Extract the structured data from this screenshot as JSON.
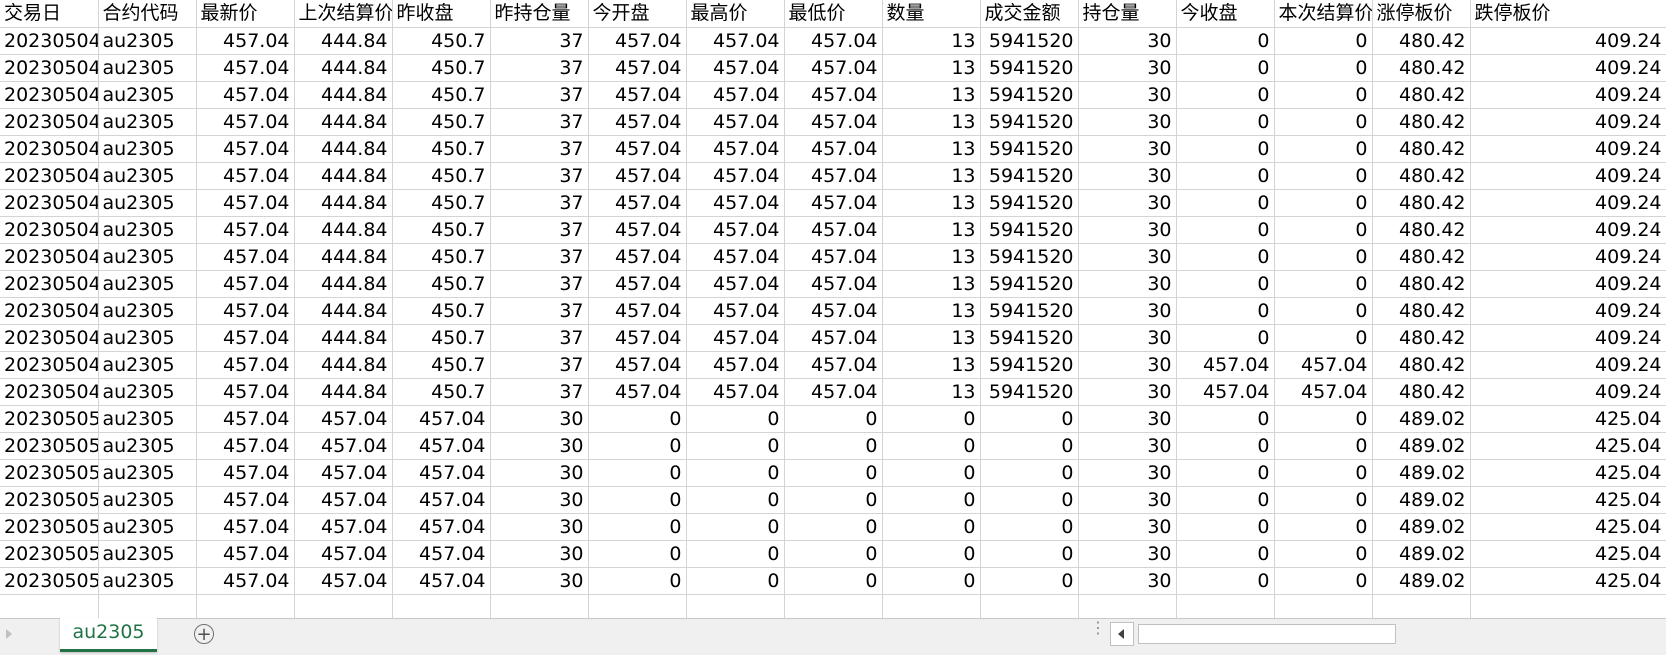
{
  "sheet": {
    "columns": [
      "交易日",
      "合约代码",
      "最新价",
      "上次结算价",
      "昨收盘",
      "昨持仓量",
      "今开盘",
      "最高价",
      "最低价",
      "数量",
      "成交金额",
      "持仓量",
      "今收盘",
      "本次结算价",
      "涨停板价",
      "跌停板价"
    ],
    "rows": [
      [
        "20230504",
        "au2305",
        "457.04",
        "444.84",
        "450.7",
        "37",
        "457.04",
        "457.04",
        "457.04",
        "13",
        "5941520",
        "30",
        "0",
        "0",
        "480.42",
        "409.24"
      ],
      [
        "20230504",
        "au2305",
        "457.04",
        "444.84",
        "450.7",
        "37",
        "457.04",
        "457.04",
        "457.04",
        "13",
        "5941520",
        "30",
        "0",
        "0",
        "480.42",
        "409.24"
      ],
      [
        "20230504",
        "au2305",
        "457.04",
        "444.84",
        "450.7",
        "37",
        "457.04",
        "457.04",
        "457.04",
        "13",
        "5941520",
        "30",
        "0",
        "0",
        "480.42",
        "409.24"
      ],
      [
        "20230504",
        "au2305",
        "457.04",
        "444.84",
        "450.7",
        "37",
        "457.04",
        "457.04",
        "457.04",
        "13",
        "5941520",
        "30",
        "0",
        "0",
        "480.42",
        "409.24"
      ],
      [
        "20230504",
        "au2305",
        "457.04",
        "444.84",
        "450.7",
        "37",
        "457.04",
        "457.04",
        "457.04",
        "13",
        "5941520",
        "30",
        "0",
        "0",
        "480.42",
        "409.24"
      ],
      [
        "20230504",
        "au2305",
        "457.04",
        "444.84",
        "450.7",
        "37",
        "457.04",
        "457.04",
        "457.04",
        "13",
        "5941520",
        "30",
        "0",
        "0",
        "480.42",
        "409.24"
      ],
      [
        "20230504",
        "au2305",
        "457.04",
        "444.84",
        "450.7",
        "37",
        "457.04",
        "457.04",
        "457.04",
        "13",
        "5941520",
        "30",
        "0",
        "0",
        "480.42",
        "409.24"
      ],
      [
        "20230504",
        "au2305",
        "457.04",
        "444.84",
        "450.7",
        "37",
        "457.04",
        "457.04",
        "457.04",
        "13",
        "5941520",
        "30",
        "0",
        "0",
        "480.42",
        "409.24"
      ],
      [
        "20230504",
        "au2305",
        "457.04",
        "444.84",
        "450.7",
        "37",
        "457.04",
        "457.04",
        "457.04",
        "13",
        "5941520",
        "30",
        "0",
        "0",
        "480.42",
        "409.24"
      ],
      [
        "20230504",
        "au2305",
        "457.04",
        "444.84",
        "450.7",
        "37",
        "457.04",
        "457.04",
        "457.04",
        "13",
        "5941520",
        "30",
        "0",
        "0",
        "480.42",
        "409.24"
      ],
      [
        "20230504",
        "au2305",
        "457.04",
        "444.84",
        "450.7",
        "37",
        "457.04",
        "457.04",
        "457.04",
        "13",
        "5941520",
        "30",
        "0",
        "0",
        "480.42",
        "409.24"
      ],
      [
        "20230504",
        "au2305",
        "457.04",
        "444.84",
        "450.7",
        "37",
        "457.04",
        "457.04",
        "457.04",
        "13",
        "5941520",
        "30",
        "0",
        "0",
        "480.42",
        "409.24"
      ],
      [
        "20230504",
        "au2305",
        "457.04",
        "444.84",
        "450.7",
        "37",
        "457.04",
        "457.04",
        "457.04",
        "13",
        "5941520",
        "30",
        "457.04",
        "457.04",
        "480.42",
        "409.24"
      ],
      [
        "20230504",
        "au2305",
        "457.04",
        "444.84",
        "450.7",
        "37",
        "457.04",
        "457.04",
        "457.04",
        "13",
        "5941520",
        "30",
        "457.04",
        "457.04",
        "480.42",
        "409.24"
      ],
      [
        "20230505",
        "au2305",
        "457.04",
        "457.04",
        "457.04",
        "30",
        "0",
        "0",
        "0",
        "0",
        "0",
        "30",
        "0",
        "0",
        "489.02",
        "425.04"
      ],
      [
        "20230505",
        "au2305",
        "457.04",
        "457.04",
        "457.04",
        "30",
        "0",
        "0",
        "0",
        "0",
        "0",
        "30",
        "0",
        "0",
        "489.02",
        "425.04"
      ],
      [
        "20230505",
        "au2305",
        "457.04",
        "457.04",
        "457.04",
        "30",
        "0",
        "0",
        "0",
        "0",
        "0",
        "30",
        "0",
        "0",
        "489.02",
        "425.04"
      ],
      [
        "20230505",
        "au2305",
        "457.04",
        "457.04",
        "457.04",
        "30",
        "0",
        "0",
        "0",
        "0",
        "0",
        "30",
        "0",
        "0",
        "489.02",
        "425.04"
      ],
      [
        "20230505",
        "au2305",
        "457.04",
        "457.04",
        "457.04",
        "30",
        "0",
        "0",
        "0",
        "0",
        "0",
        "30",
        "0",
        "0",
        "489.02",
        "425.04"
      ],
      [
        "20230505",
        "au2305",
        "457.04",
        "457.04",
        "457.04",
        "30",
        "0",
        "0",
        "0",
        "0",
        "0",
        "30",
        "0",
        "0",
        "489.02",
        "425.04"
      ],
      [
        "20230505",
        "au2305",
        "457.04",
        "457.04",
        "457.04",
        "30",
        "0",
        "0",
        "0",
        "0",
        "0",
        "30",
        "0",
        "0",
        "489.02",
        "425.04"
      ],
      [
        "",
        "",
        "",
        "",
        "",
        "",
        "",
        "",
        "",
        "",
        "",
        "",
        "",
        "",
        "",
        ""
      ]
    ]
  },
  "tabbar": {
    "active_tab": "au2305",
    "add_label": "+",
    "accent_color": "#217346"
  },
  "icons": {
    "nav_prev": "triangle-right-icon",
    "add_sheet": "plus-circle-icon",
    "options": "vertical-dots-icon",
    "scroll_left": "triangle-left-icon"
  }
}
